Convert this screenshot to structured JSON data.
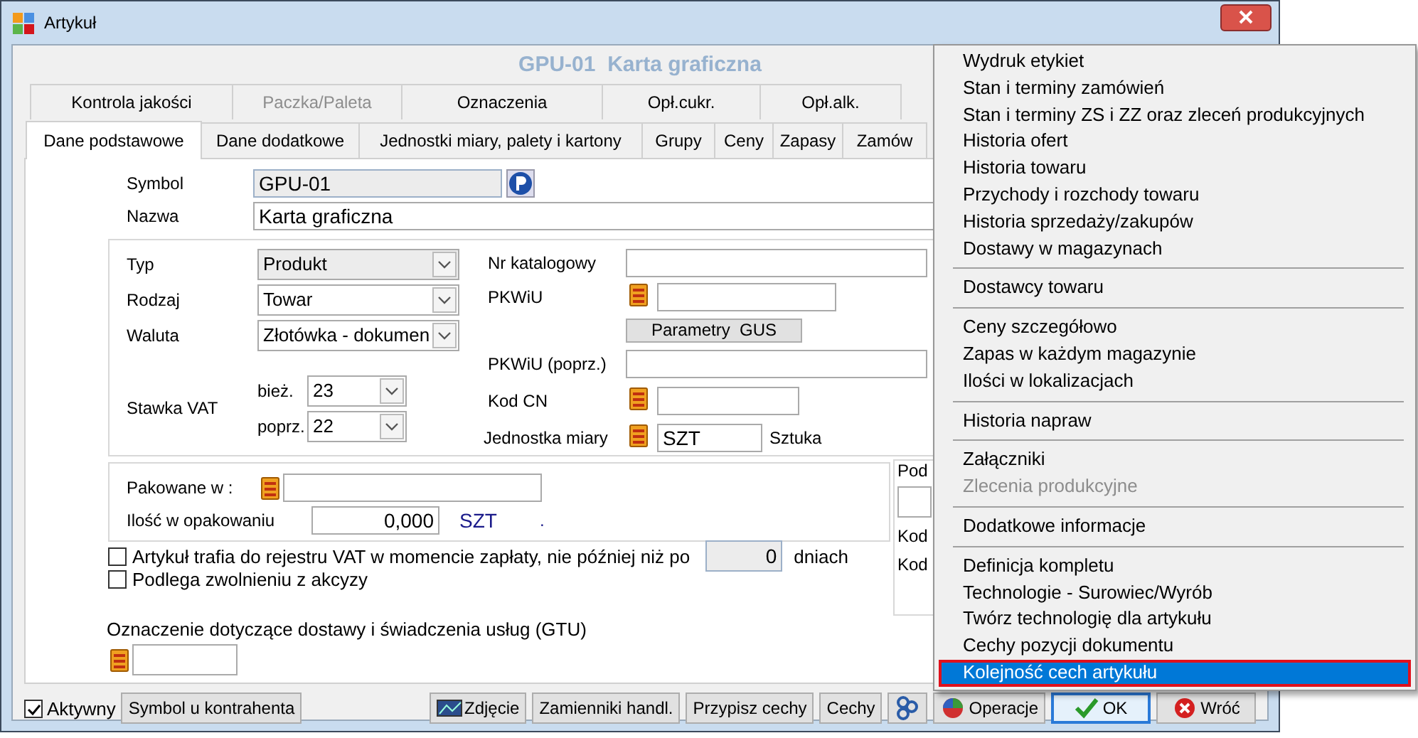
{
  "window": {
    "title": "Artykuł"
  },
  "heading": "GPU-01  Karta graficzna",
  "tabs_top": [
    {
      "label": "Kontrola jakości",
      "selected": false,
      "disabled": false
    },
    {
      "label": "Paczka/Paleta",
      "selected": false,
      "disabled": true
    },
    {
      "label": "Oznaczenia",
      "selected": false,
      "disabled": false
    },
    {
      "label": "Opł.cukr.",
      "selected": false,
      "disabled": false
    },
    {
      "label": "Opł.alk.",
      "selected": false,
      "disabled": false
    }
  ],
  "tabs": [
    {
      "label": "Dane podstawowe",
      "selected": true
    },
    {
      "label": "Dane dodatkowe",
      "selected": false
    },
    {
      "label": "Jednostki miary, palety i kartony",
      "selected": false
    },
    {
      "label": "Grupy",
      "selected": false
    },
    {
      "label": "Ceny",
      "selected": false
    },
    {
      "label": "Zapasy",
      "selected": false
    },
    {
      "label": "Zamów",
      "selected": false
    }
  ],
  "symbol": {
    "label": "Symbol",
    "value": "GPU-01",
    "disabled": true
  },
  "name": {
    "label": "Nazwa",
    "value": "Karta graficzna",
    "disabled": false
  },
  "type": {
    "label": "Typ",
    "value": "Produkt",
    "disabled": true
  },
  "kind": {
    "label": "Rodzaj",
    "value": "Towar",
    "disabled": false
  },
  "currency": {
    "label": "Waluta",
    "value": "Złotówka - dokumen",
    "disabled": false
  },
  "vat": {
    "label": "Stawka VAT",
    "current_label": "bież.",
    "current": "23",
    "previous_label": "poprz.",
    "previous": "22"
  },
  "catalog_no": {
    "label": "Nr katalogowy"
  },
  "pkwiu": {
    "label": "PKWiU"
  },
  "gus_button": "Parametry  GUS",
  "pkwiu_prev": {
    "label": "PKWiU (poprz.)"
  },
  "cn_code": {
    "label": "Kod CN"
  },
  "unit": {
    "label": "Jednostka miary",
    "value": "SZT",
    "description": "Sztuka"
  },
  "packaging": {
    "label": "Pakowane w :",
    "qty_label": "Ilość w opakowaniu",
    "qty_value": "0,000",
    "qty_unit": "SZT",
    "mark": "."
  },
  "side_group": {
    "title": "Pod",
    "labels": [
      "Kod",
      "Kod"
    ]
  },
  "checks": [
    {
      "label": "Artykuł trafia do rejestru VAT w momencie zapłaty, nie później niż po",
      "checked": false,
      "value": "0",
      "suffix": "dniach"
    },
    {
      "label": "Podlega zwolnieniu z akcyzy",
      "checked": false
    }
  ],
  "gtu": {
    "label": "Oznaczenie dotyczące dostawy i świadczenia usług (GTU)"
  },
  "active": {
    "label": "Aktywny",
    "checked": true
  },
  "buttons_left": [
    {
      "label": "Symbol u kontrahenta",
      "kind": "plain"
    }
  ],
  "buttons_right": [
    {
      "label": "Zdjęcie",
      "kind": "image"
    },
    {
      "label": "Zamienniki handl.",
      "kind": "plain"
    },
    {
      "label": "Przypisz cechy",
      "kind": "plain"
    },
    {
      "label": "Cechy",
      "kind": "plain"
    },
    {
      "kind": "links"
    },
    {
      "label": "Operacje",
      "kind": "operations"
    },
    {
      "label": "OK",
      "kind": "confirm"
    },
    {
      "label": "Wróć",
      "kind": "cancel"
    }
  ],
  "menu": [
    {
      "kind": "item",
      "label": "Wydruk etykiet",
      "disabled": false,
      "selected": false
    },
    {
      "kind": "item",
      "label": "Stan i terminy zamówień",
      "disabled": false,
      "selected": false
    },
    {
      "kind": "item",
      "label": "Stan i terminy ZS i ZZ oraz zleceń produkcyjnych",
      "disabled": false,
      "selected": false
    },
    {
      "kind": "item",
      "label": "Historia  ofert",
      "disabled": false,
      "selected": false
    },
    {
      "kind": "item",
      "label": "Historia towaru",
      "disabled": false,
      "selected": false
    },
    {
      "kind": "item",
      "label": "Przychody i rozchody towaru",
      "disabled": false,
      "selected": false
    },
    {
      "kind": "item",
      "label": "Historia sprzedaży/zakupów",
      "disabled": false,
      "selected": false
    },
    {
      "kind": "item",
      "label": "Dostawy w magazynach",
      "disabled": false,
      "selected": false
    },
    {
      "kind": "separator"
    },
    {
      "kind": "item",
      "label": "Dostawcy towaru",
      "disabled": false,
      "selected": false
    },
    {
      "kind": "separator"
    },
    {
      "kind": "item",
      "label": "Ceny szczegółowo",
      "disabled": false,
      "selected": false
    },
    {
      "kind": "item",
      "label": "Zapas w każdym magazynie",
      "disabled": false,
      "selected": false
    },
    {
      "kind": "item",
      "label": "Ilości w lokalizacjach",
      "disabled": false,
      "selected": false
    },
    {
      "kind": "separator"
    },
    {
      "kind": "item",
      "label": "Historia napraw",
      "disabled": false,
      "selected": false
    },
    {
      "kind": "separator"
    },
    {
      "kind": "item",
      "label": "Załączniki",
      "disabled": false,
      "selected": false
    },
    {
      "kind": "item",
      "label": "Zlecenia produkcyjne",
      "disabled": true,
      "selected": false
    },
    {
      "kind": "separator"
    },
    {
      "kind": "item",
      "label": "Dodatkowe informacje",
      "disabled": false,
      "selected": false
    },
    {
      "kind": "separator"
    },
    {
      "kind": "item",
      "label": "Definicja kompletu",
      "disabled": false,
      "selected": false
    },
    {
      "kind": "item",
      "label": "Technologie - Surowiec/Wyrób",
      "disabled": false,
      "selected": false
    },
    {
      "kind": "item",
      "label": "Twórz technologię dla artykułu",
      "disabled": false,
      "selected": false
    },
    {
      "kind": "item",
      "label": "Cechy pozycji dokumentu",
      "disabled": false,
      "selected": false
    },
    {
      "kind": "item",
      "label": "Kolejność cech artykułu",
      "disabled": false,
      "selected": true
    }
  ]
}
